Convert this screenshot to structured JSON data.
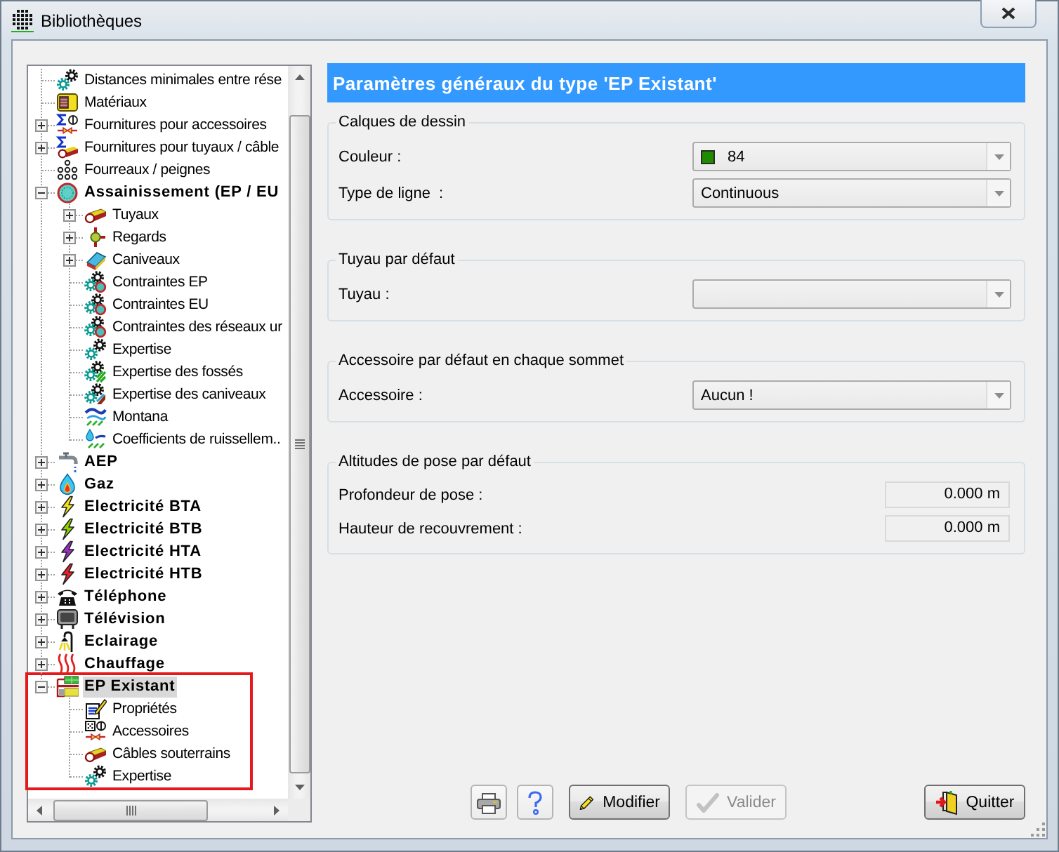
{
  "window": {
    "title": "Bibliothèques"
  },
  "tree": {
    "items": [
      {
        "label": "Distances minimales entre rése",
        "kind": "gears",
        "bold": false,
        "selected": false,
        "outlined": false
      },
      {
        "label": "Matériaux",
        "kind": "crate",
        "bold": false,
        "selected": false,
        "outlined": false
      },
      {
        "label": "Fournitures pour accessoires",
        "kind": "sigma-fitting",
        "bold": false,
        "selected": false,
        "outlined": false,
        "expanded": false
      },
      {
        "label": "Fournitures pour tuyaux / câble",
        "kind": "sigma-pipe",
        "bold": false,
        "selected": false,
        "outlined": false,
        "expanded": false
      },
      {
        "label": "Fourreaux / peignes",
        "kind": "dots",
        "bold": false,
        "selected": false,
        "outlined": false
      },
      {
        "label": "Assainissement (EP / EU",
        "kind": "ring",
        "bold": true,
        "selected": false,
        "outlined": false,
        "expanded": true,
        "children": [
          {
            "label": "Tuyaux",
            "kind": "pipe",
            "bold": false,
            "selected": false,
            "expanded": false
          },
          {
            "label": "Regards",
            "kind": "junction",
            "bold": false,
            "selected": false,
            "expanded": false
          },
          {
            "label": "Caniveaux",
            "kind": "channel",
            "bold": false,
            "selected": false,
            "expanded": false
          },
          {
            "label": "Contraintes EP",
            "kind": "gears-ring",
            "bold": false,
            "selected": false
          },
          {
            "label": "Contraintes EU",
            "kind": "gears-ring",
            "bold": false,
            "selected": false
          },
          {
            "label": "Contraintes des réseaux ur",
            "kind": "gears-ring",
            "bold": false,
            "selected": false
          },
          {
            "label": "Expertise",
            "kind": "gears",
            "bold": false,
            "selected": false
          },
          {
            "label": "Expertise des fossés",
            "kind": "gears-ditch",
            "bold": false,
            "selected": false
          },
          {
            "label": "Expertise des caniveaux",
            "kind": "gears-channel",
            "bold": false,
            "selected": false
          },
          {
            "label": "Montana",
            "kind": "rain",
            "bold": false,
            "selected": false
          },
          {
            "label": "Coefficients de ruissellem..",
            "kind": "runoff",
            "bold": false,
            "selected": false
          }
        ]
      },
      {
        "label": "AEP",
        "kind": "tap",
        "bold": true,
        "selected": false,
        "outlined": false,
        "expanded": false
      },
      {
        "label": "Gaz",
        "kind": "flame",
        "bold": true,
        "selected": false,
        "outlined": false,
        "expanded": false
      },
      {
        "label": "Electricité BTA",
        "kind": "bolt",
        "color": "#f2e21c",
        "bold": true,
        "selected": false,
        "outlined": false,
        "expanded": false
      },
      {
        "label": "Electricité BTB",
        "kind": "bolt",
        "color": "#8fd400",
        "bold": true,
        "selected": false,
        "outlined": false,
        "expanded": false
      },
      {
        "label": "Electricité HTA",
        "kind": "bolt",
        "color": "#9a2fc6",
        "bold": true,
        "selected": false,
        "outlined": false,
        "expanded": false
      },
      {
        "label": "Electricité HTB",
        "kind": "bolt",
        "color": "#e8202a",
        "bold": true,
        "selected": false,
        "outlined": false,
        "expanded": false
      },
      {
        "label": "Téléphone",
        "kind": "phone",
        "bold": true,
        "selected": false,
        "outlined": false,
        "expanded": false
      },
      {
        "label": "Télévision",
        "kind": "tv",
        "bold": true,
        "selected": false,
        "outlined": false,
        "expanded": false
      },
      {
        "label": "Eclairage",
        "kind": "lamp",
        "bold": true,
        "selected": false,
        "outlined": false,
        "expanded": false
      },
      {
        "label": "Chauffage",
        "kind": "heat",
        "bold": true,
        "selected": false,
        "outlined": false,
        "expanded": false
      },
      {
        "label": "EP Existant",
        "kind": "layers",
        "bold": true,
        "selected": true,
        "outlined": true,
        "expanded": true,
        "children": [
          {
            "label": "Propriétés",
            "kind": "properties",
            "bold": false,
            "selected": false
          },
          {
            "label": "Accessoires",
            "kind": "fitting",
            "bold": false,
            "selected": false
          },
          {
            "label": "Câbles souterrains",
            "kind": "pipe",
            "bold": false,
            "selected": false
          },
          {
            "label": "Expertise",
            "kind": "gears",
            "bold": false,
            "selected": false
          }
        ]
      }
    ]
  },
  "panel": {
    "title": "Paramètres généraux du type 'EP Existant'",
    "groups": [
      {
        "title": "Calques de dessin",
        "fields": [
          {
            "label": "Couleur :",
            "kind": "dropdown",
            "value": "84",
            "color": "#1f8c00"
          },
          {
            "label": "Type de ligne  :",
            "kind": "dropdown",
            "value": "Continuous"
          }
        ]
      },
      {
        "title": "Tuyau par défaut",
        "fields": [
          {
            "label": "Tuyau :",
            "kind": "dropdown"
          }
        ]
      },
      {
        "title": "Accessoire par défaut en chaque sommet",
        "fields": [
          {
            "label": "Accessoire :",
            "kind": "dropdown",
            "value": "Aucun !"
          }
        ]
      },
      {
        "title": "Altitudes de pose par défaut",
        "fields": [
          {
            "label": "Profondeur de pose :",
            "kind": "text",
            "value": "0.000 m"
          },
          {
            "label": "Hauteur de recouvrement :",
            "kind": "text",
            "value": "0.000 m"
          }
        ]
      }
    ]
  },
  "buttons": [
    {
      "kind": "print",
      "disabled": false
    },
    {
      "kind": "help",
      "disabled": false
    },
    {
      "kind": "edit",
      "label": "Modifier",
      "disabled": false
    },
    {
      "kind": "confirm",
      "label": "Valider",
      "disabled": true
    },
    {
      "kind": "exit",
      "label": "Quitter",
      "disabled": false
    }
  ]
}
